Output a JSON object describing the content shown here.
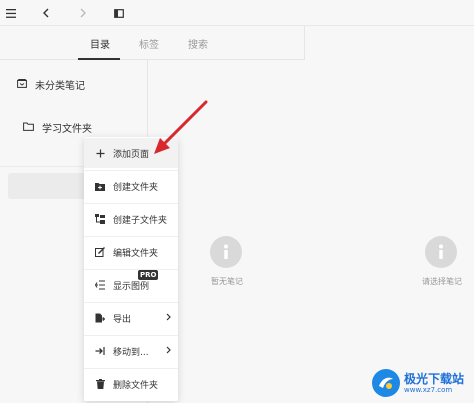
{
  "tabs": [
    {
      "label": "目录",
      "active": true
    },
    {
      "label": "标签",
      "active": false
    },
    {
      "label": "搜索",
      "active": false
    }
  ],
  "sidebar": {
    "uncategorized": "未分类笔记",
    "folder": "学习文件夹"
  },
  "notes_empty": "暂无笔记",
  "content_empty": "请选择笔记",
  "context_menu": {
    "items": [
      {
        "label": "添加页面",
        "icon": "plus-icon",
        "submenu": false
      },
      {
        "label": "创建文件夹",
        "icon": "new-folder-icon",
        "submenu": false
      },
      {
        "label": "创建子文件夹",
        "icon": "subfolder-icon",
        "submenu": false
      },
      {
        "label": "编辑文件夹",
        "icon": "edit-icon",
        "submenu": false
      },
      {
        "label": "显示图例",
        "icon": "legend-icon",
        "submenu": false
      },
      {
        "label": "导出",
        "icon": "export-icon",
        "submenu": true
      },
      {
        "label": "移动到...",
        "icon": "move-icon",
        "submenu": true
      },
      {
        "label": "删除文件夹",
        "icon": "trash-icon",
        "submenu": false
      }
    ],
    "pro_badge": "PRO"
  },
  "watermark": {
    "title": "极光下载站",
    "url": "www.xz7.com"
  },
  "colors": {
    "accent_arrow": "#d9272e",
    "watermark_blue": "#1e88e5"
  }
}
